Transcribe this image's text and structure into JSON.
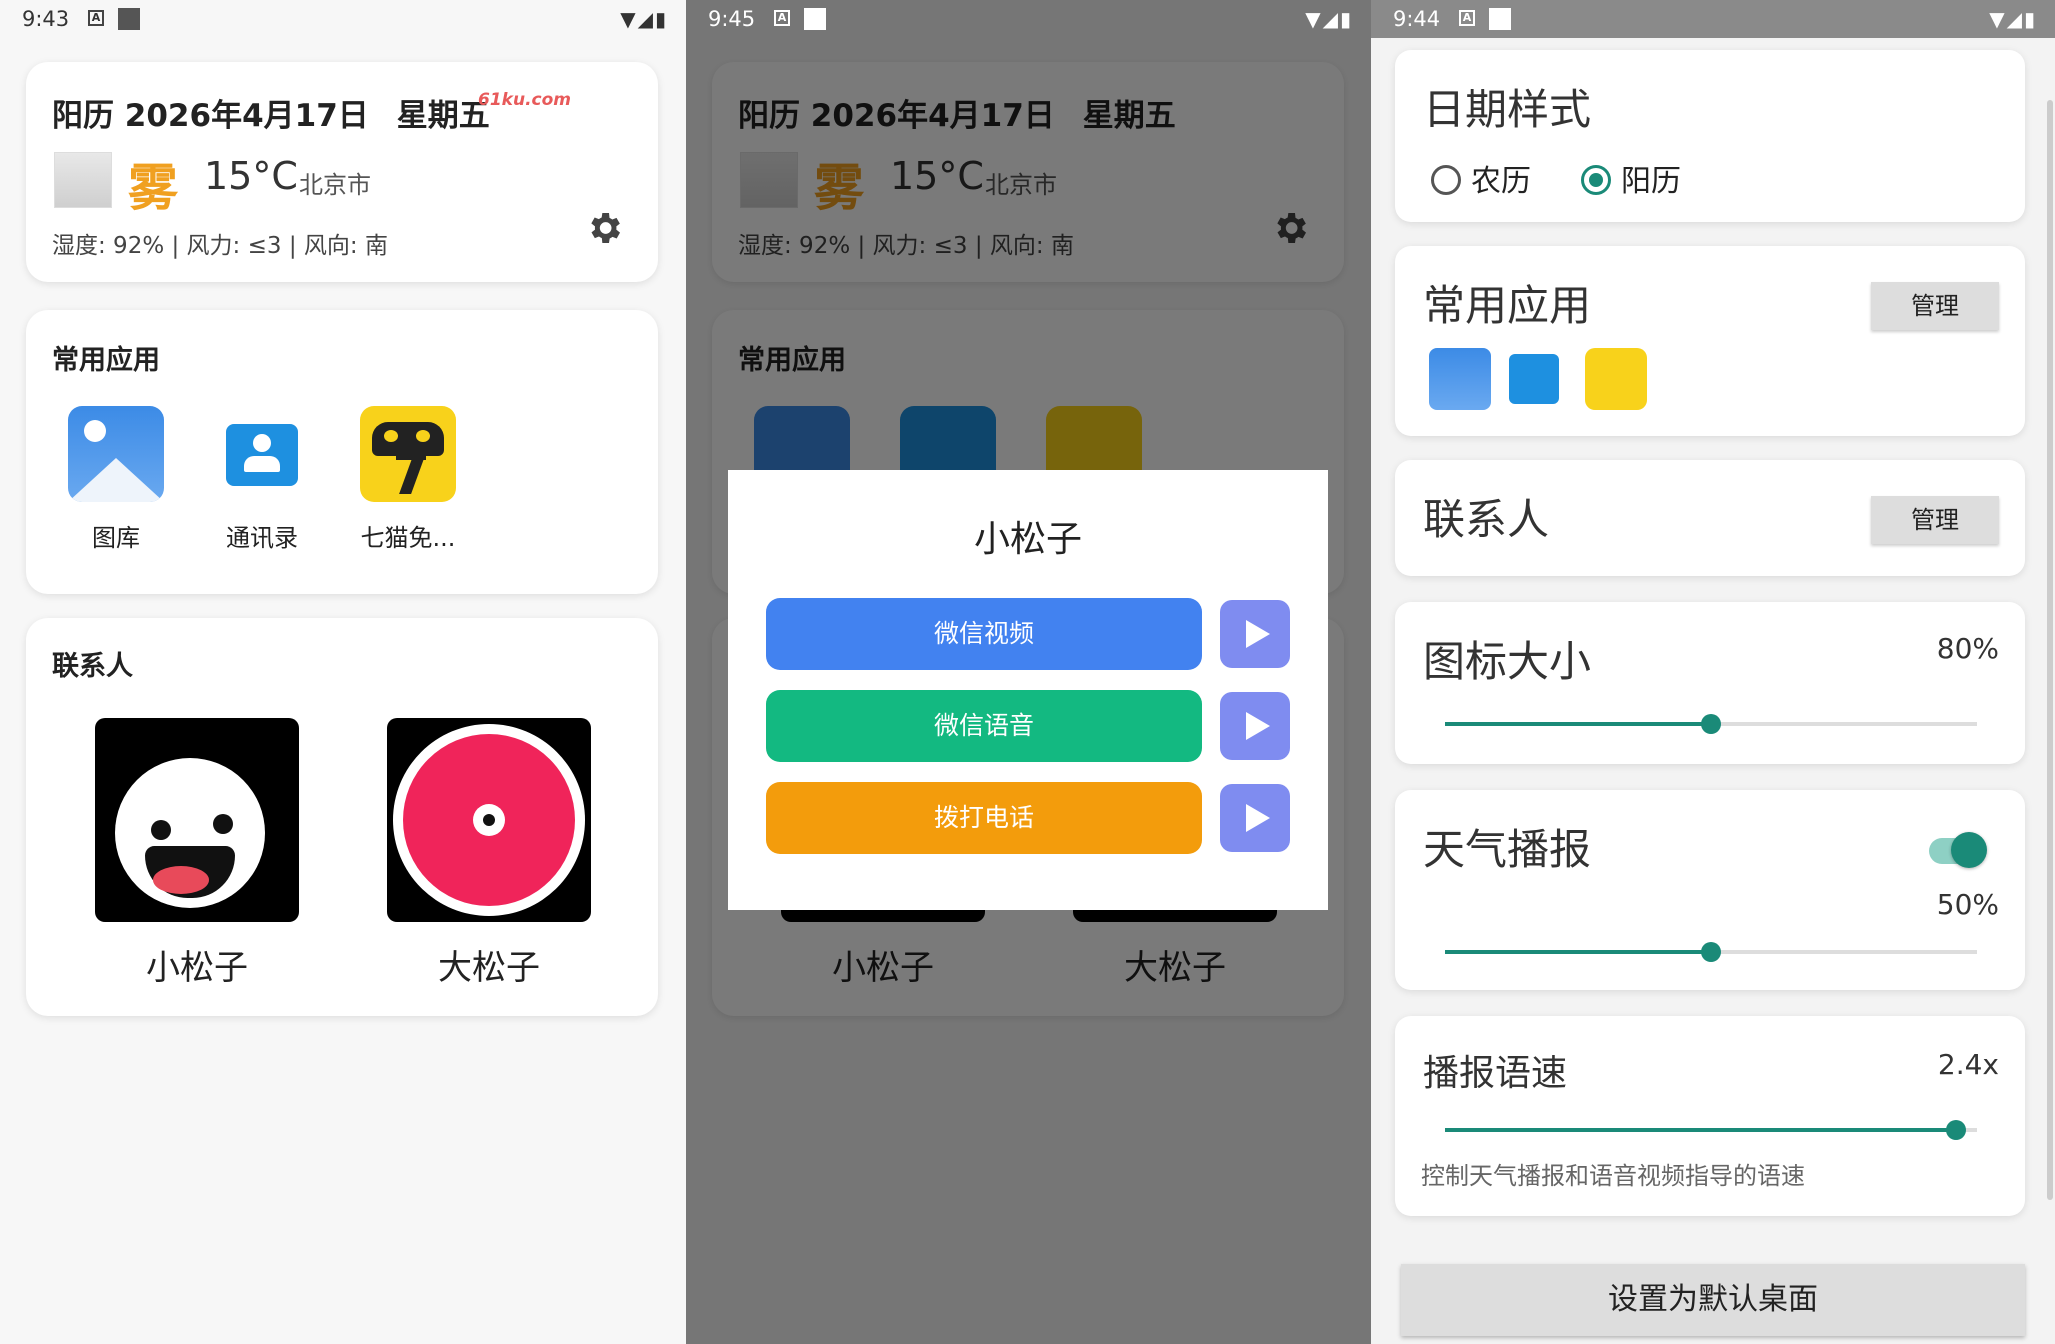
{
  "status": [
    {
      "time": "9:43"
    },
    {
      "time": "9:45"
    },
    {
      "time": "9:44"
    }
  ],
  "weather": {
    "date_text": "阳历 2026年4月17日",
    "weekday": "星期五",
    "watermark": "61ku.com",
    "condition": "雾",
    "temperature": "15°C",
    "city": "北京市",
    "details": "湿度: 92% | 风力: ≤3 | 风向: 南"
  },
  "apps": {
    "title": "常用应用",
    "items": [
      {
        "label": "图库",
        "icon": "gallery-icon"
      },
      {
        "label": "通讯录",
        "icon": "contacts-icon"
      },
      {
        "label": "七猫免...",
        "icon": "qimao-icon"
      }
    ]
  },
  "contacts": {
    "title": "联系人",
    "items": [
      {
        "label": "小松子",
        "icon": "monster-avatar-icon"
      },
      {
        "label": "大松子",
        "icon": "music-disc-avatar-icon"
      }
    ]
  },
  "dialog": {
    "title": "小松子",
    "buttons": [
      {
        "label": "微信视频",
        "color": "#4282f0"
      },
      {
        "label": "微信语音",
        "color": "#13b981"
      },
      {
        "label": "拨打电话",
        "color": "#f39c0c"
      }
    ],
    "play_color": "#7f8cf0"
  },
  "settings": {
    "date_style": {
      "title": "日期样式",
      "options": [
        "农历",
        "阳历"
      ],
      "selected": "阳历"
    },
    "common_apps": {
      "title": "常用应用",
      "manage": "管理"
    },
    "contacts": {
      "title": "联系人",
      "manage": "管理"
    },
    "icon_size": {
      "title": "图标大小",
      "value_text": "80%",
      "value": 0.5
    },
    "weather_report": {
      "title": "天气播报",
      "enabled": true,
      "volume_text": "50%",
      "volume": 0.5
    },
    "speech_rate": {
      "title": "播报语速",
      "value_text": "2.4x",
      "value": 0.96,
      "hint": "控制天气播报和语音视频指导的语速"
    },
    "default_button": "设置为默认桌面"
  },
  "colors": {
    "accent": "#1a8a78",
    "weather_condition": "#f0a020"
  }
}
